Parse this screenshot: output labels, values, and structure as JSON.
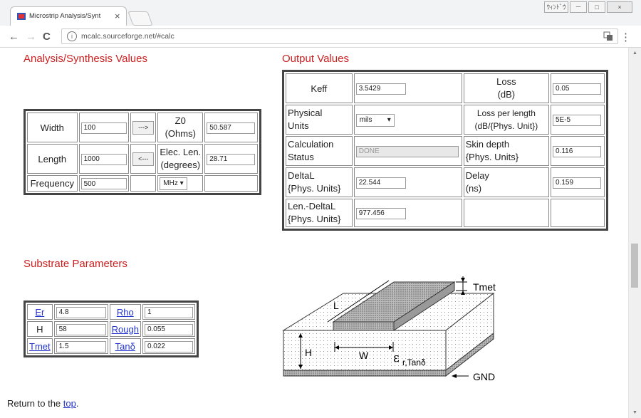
{
  "browser": {
    "tab_title": "Microstrip Analysis/Synt",
    "tab_close": "×",
    "window_buttons": [
      "ｳｨﾝﾄﾞｳ",
      "－",
      "□",
      "×"
    ],
    "nav": {
      "back": "←",
      "forward": "→",
      "reload": "C"
    },
    "url": "mcalc.sourceforge.net/#calc",
    "menu": "⋮"
  },
  "analysis": {
    "heading": "Analysis/Synthesis Values",
    "width_label": "Width",
    "width_value": "100",
    "synth_button": "--->",
    "z0_label_1": "Z0",
    "z0_label_2": "(Ohms)",
    "z0_value": "50.587",
    "length_label": "Length",
    "length_value": "1000",
    "analyze_button": "<---",
    "elec_len_label_1": "Elec. Len.",
    "elec_len_label_2": "(degrees)",
    "elec_len_value": "28.71",
    "frequency_label": "Frequency",
    "frequency_value": "500",
    "freq_unit": "MHz"
  },
  "output": {
    "heading": "Output Values",
    "keff_label": "Keff",
    "keff_value": "3.5429",
    "loss_label_1": "Loss",
    "loss_label_2": "(dB)",
    "loss_value": "0.05",
    "phys_units_label_1": "Physical",
    "phys_units_label_2": "Units",
    "phys_units_value": "mils",
    "loss_per_len_label_1": "Loss per length",
    "loss_per_len_label_2": "(dB/{Phys. Unit})",
    "loss_per_len_value": "5E-5",
    "calc_status_label_1": "Calculation",
    "calc_status_label_2": "Status",
    "calc_status_value": "DONE",
    "skin_depth_label_1": "Skin depth",
    "skin_depth_label_2": "{Phys. Units}",
    "skin_depth_value": "0.116",
    "deltal_label_1": "DeltaL",
    "deltal_label_2": "{Phys. Units}",
    "deltal_value": "22.544",
    "delay_label_1": "Delay",
    "delay_label_2": "(ns)",
    "delay_value": "0.159",
    "len_deltal_label_1": "Len.-DeltaL",
    "len_deltal_label_2": "{Phys. Units}",
    "len_deltal_value": "977.456"
  },
  "substrate": {
    "heading": "Substrate Parameters",
    "er_label": "Er",
    "er_value": "4.8",
    "rho_label": "Rho",
    "rho_value": "1",
    "h_label": "H",
    "h_value": "58",
    "rough_label": "Rough",
    "rough_value": "0.055",
    "tmet_label": "Tmet",
    "tmet_value": "1.5",
    "tand_label": "Tanδ",
    "tand_value": "0.022"
  },
  "diagram": {
    "tmet": "Tmet",
    "l": "L",
    "h": "H",
    "w": "W",
    "eps": "ε",
    "eps_sub": "r,Tanδ",
    "gnd": "GND"
  },
  "footer": {
    "prefix": "Return to the ",
    "link": "top",
    "suffix": "."
  }
}
